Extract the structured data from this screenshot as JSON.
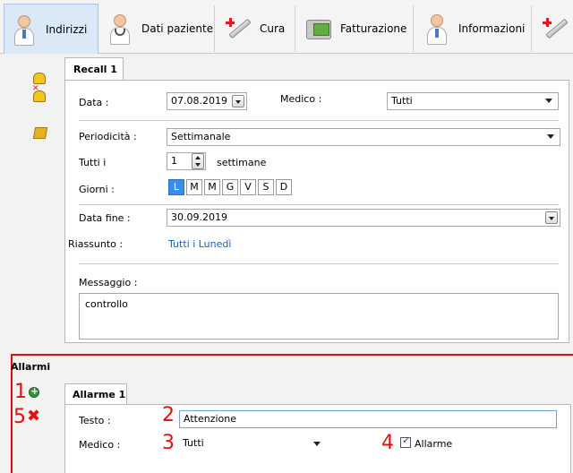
{
  "tabs": [
    {
      "label": "Indirizzi",
      "active": true,
      "icon": "doctor-icon"
    },
    {
      "label": "Dati paziente",
      "active": false,
      "icon": "doctor-icon"
    },
    {
      "label": "Cura",
      "active": false,
      "icon": "syringe-icon"
    },
    {
      "label": "Fatturazione",
      "active": false,
      "icon": "billing-icon"
    },
    {
      "label": "Informazioni",
      "active": false,
      "icon": "doctor-icon"
    }
  ],
  "recall": {
    "tab_label": "Recall 1",
    "data_label": "Data :",
    "data_value": "07.08.2019",
    "medico_label": "Medico :",
    "medico_value": "Tutti",
    "periodicita_label": "Periodicità :",
    "periodicita_value": "Settimanale",
    "tutti_label": "Tutti i",
    "tutti_value": "1",
    "tutti_unit": "settimane",
    "giorni_label": "Giorni :",
    "giorni": [
      {
        "label": "L",
        "selected": true
      },
      {
        "label": "M",
        "selected": false
      },
      {
        "label": "M",
        "selected": false
      },
      {
        "label": "G",
        "selected": false
      },
      {
        "label": "V",
        "selected": false
      },
      {
        "label": "S",
        "selected": false
      },
      {
        "label": "D",
        "selected": false
      }
    ],
    "data_fine_label": "Data fine :",
    "data_fine_value": "30.09.2019",
    "riassunto_label": "Riassunto :",
    "riassunto_value": "Tutti i Lunedì",
    "messaggio_label": "Messaggio :",
    "messaggio_value": "controllo"
  },
  "allarmi": {
    "title": "Allarmi",
    "tab_label": "Allarme 1",
    "testo_label": "Testo :",
    "testo_value": "Attenzione",
    "medico_label": "Medico :",
    "medico_value": "Tutti",
    "allarme_label": "Allarme",
    "allarme_checked": true,
    "markers": [
      "1",
      "2",
      "3",
      "4",
      "5"
    ]
  },
  "colors": {
    "accent": "#e01010",
    "selected_day": "#3a8ee6",
    "link": "#1a5fb4"
  }
}
